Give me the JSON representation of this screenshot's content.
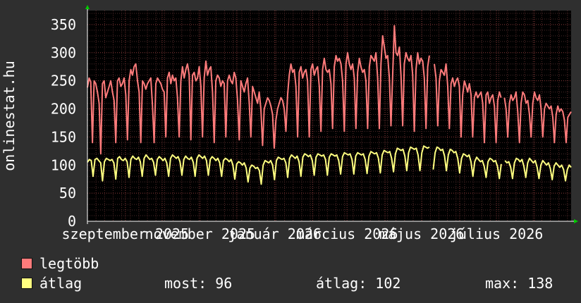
{
  "chart_data": {
    "type": "line",
    "ylabel": "onlinestat.hu",
    "ylim": [
      0,
      375
    ],
    "yticks": [
      0,
      50,
      100,
      150,
      200,
      250,
      300,
      350
    ],
    "xticks": [
      "szeptember 2025",
      "november 2025",
      "január 2026",
      "március 2026",
      "május 2026",
      "július 2026"
    ],
    "x_range": [
      "2025-08-01",
      "2026-08-31"
    ],
    "grid": true,
    "background": "#000000",
    "series": [
      {
        "name": "legtöbb",
        "color": "#ff7b7b",
        "gaps": [
          [
            "2026-05-08",
            "2026-05-10"
          ],
          [
            "2026-07-06",
            "2026-07-07"
          ]
        ],
        "values": [
          238,
          255,
          248,
          140,
          250,
          245,
          230,
          210,
          120,
          245,
          250,
          220,
          230,
          240,
          250,
          230,
          215,
          140,
          250,
          255,
          240,
          245,
          255,
          225,
          145,
          250,
          270,
          260,
          275,
          280,
          250,
          230,
          140,
          250,
          245,
          235,
          245,
          250,
          255,
          205,
          140,
          245,
          255,
          250,
          245,
          235,
          230,
          150,
          255,
          265,
          245,
          260,
          250,
          255,
          220,
          150,
          250,
          275,
          255,
          270,
          280,
          260,
          145,
          260,
          265,
          250,
          255,
          275,
          240,
          150,
          255,
          285,
          260,
          270,
          275,
          230,
          140,
          250,
          260,
          255,
          240,
          250,
          245,
          150,
          250,
          260,
          250,
          245,
          265,
          255,
          215,
          145,
          250,
          240,
          230,
          245,
          255,
          210,
          150,
          240,
          230,
          220,
          210,
          230,
          200,
          135,
          200,
          210,
          220,
          215,
          205,
          190,
          130,
          180,
          200,
          210,
          220,
          215,
          200,
          160,
          225,
          260,
          280,
          265,
          270,
          240,
          150,
          265,
          275,
          255,
          265,
          270,
          250,
          150,
          270,
          280,
          260,
          270,
          275,
          240,
          160,
          270,
          290,
          270,
          265,
          270,
          245,
          165,
          275,
          295,
          285,
          290,
          280,
          250,
          160,
          280,
          300,
          280,
          270,
          280,
          255,
          165,
          265,
          290,
          275,
          265,
          270,
          250,
          165,
          275,
          295,
          290,
          285,
          300,
          255,
          165,
          280,
          330,
          310,
          290,
          295,
          255,
          170,
          260,
          348,
          300,
          295,
          310,
          260,
          170,
          280,
          300,
          290,
          285,
          295,
          260,
          160,
          270,
          300,
          280,
          290,
          285,
          255,
          165,
          275,
          295,
          285,
          270,
          280,
          255,
          170,
          250,
          270,
          265,
          260,
          280,
          240,
          165,
          245,
          255,
          240,
          250,
          255,
          240,
          150,
          225,
          250,
          240,
          230,
          245,
          225,
          150,
          220,
          230,
          220,
          225,
          230,
          210,
          140,
          225,
          230,
          210,
          220,
          225,
          205,
          140,
          215,
          230,
          220,
          225,
          220,
          200,
          150,
          210,
          225,
          215,
          220,
          230,
          195,
          140,
          210,
          230,
          225,
          210,
          215,
          190,
          150,
          210,
          230,
          220,
          215,
          225,
          200,
          150,
          200,
          210,
          205,
          200,
          205,
          185,
          140,
          190,
          205,
          195,
          200,
          195,
          180,
          140,
          185,
          190,
          195
        ]
      },
      {
        "name": "átlag",
        "color": "#ffff80",
        "gaps": [
          [
            "2026-05-08",
            "2026-05-10"
          ],
          [
            "2026-07-06",
            "2026-07-07"
          ]
        ],
        "values": [
          105,
          110,
          108,
          80,
          110,
          112,
          108,
          104,
          72,
          106,
          112,
          110,
          108,
          110,
          104,
          75,
          112,
          115,
          110,
          108,
          112,
          106,
          78,
          110,
          116,
          112,
          110,
          114,
          106,
          80,
          112,
          118,
          114,
          110,
          112,
          105,
          82,
          110,
          115,
          112,
          108,
          112,
          104,
          80,
          112,
          118,
          115,
          112,
          115,
          106,
          82,
          110,
          116,
          112,
          110,
          114,
          105,
          80,
          112,
          118,
          115,
          112,
          116,
          108,
          82,
          110,
          115,
          112,
          108,
          112,
          104,
          80,
          108,
          112,
          110,
          106,
          110,
          100,
          75,
          102,
          106,
          104,
          100,
          104,
          95,
          70,
          95,
          100,
          98,
          94,
          96,
          90,
          66,
          100,
          108,
          106,
          104,
          108,
          100,
          74,
          108,
          114,
          112,
          110,
          112,
          104,
          78,
          112,
          118,
          115,
          112,
          116,
          106,
          80,
          114,
          120,
          118,
          115,
          118,
          108,
          82,
          114,
          120,
          118,
          116,
          118,
          110,
          82,
          114,
          120,
          118,
          116,
          118,
          108,
          84,
          115,
          122,
          120,
          118,
          120,
          110,
          84,
          116,
          122,
          120,
          118,
          120,
          110,
          85,
          116,
          124,
          122,
          120,
          122,
          112,
          86,
          118,
          126,
          124,
          122,
          124,
          112,
          88,
          120,
          130,
          128,
          126,
          128,
          116,
          90,
          122,
          132,
          130,
          128,
          130,
          118,
          90,
          122,
          134,
          132,
          130,
          132,
          118,
          92,
          122,
          132,
          130,
          126,
          128,
          116,
          90,
          118,
          128,
          126,
          122,
          124,
          112,
          86,
          112,
          120,
          118,
          115,
          118,
          106,
          80,
          106,
          114,
          110,
          106,
          108,
          98,
          78,
          106,
          112,
          110,
          106,
          108,
          98,
          76,
          102,
          110,
          108,
          104,
          106,
          96,
          76,
          104,
          112,
          110,
          106,
          110,
          98,
          78,
          104,
          112,
          108,
          104,
          108,
          96,
          76,
          100,
          108,
          104,
          100,
          104,
          94,
          74,
          98,
          104,
          100,
          96,
          100,
          92,
          72,
          92,
          100,
          96
        ]
      }
    ]
  },
  "legend": {
    "items": [
      {
        "label": "legtöbb",
        "color": "#ff7b7b"
      },
      {
        "label": "átlag",
        "color": "#ffff80"
      }
    ]
  },
  "stats": {
    "now": "most: 96",
    "avg": "átlag: 102",
    "max": "max: 138"
  }
}
